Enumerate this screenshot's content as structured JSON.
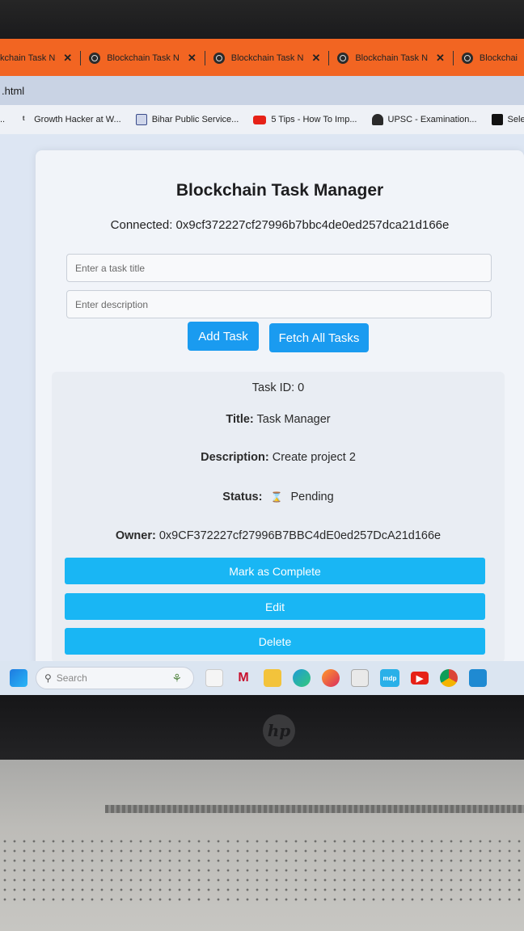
{
  "browser": {
    "tabs": [
      {
        "label": "kchain Task N"
      },
      {
        "label": "Blockchain Task N"
      },
      {
        "label": "Blockchain Task N"
      },
      {
        "label": "Blockchain Task N"
      },
      {
        "label": "Blockchai"
      }
    ],
    "address": ".html",
    "bookmarks": [
      {
        "label": "..",
        "icon": "ellipsis-icon"
      },
      {
        "label": "Growth Hacker at W...",
        "icon": "growth-hacker-icon"
      },
      {
        "label": "Bihar Public Service...",
        "icon": "bpsc-icon"
      },
      {
        "label": "5 Tips - How To Imp...",
        "icon": "youtube-icon"
      },
      {
        "label": "UPSC - Examination...",
        "icon": "upsc-emblem-icon"
      },
      {
        "label": "Sele",
        "icon": "bookmark-icon"
      }
    ]
  },
  "app": {
    "title": "Blockchain Task Manager",
    "connected_text": "Connected: 0x9cf372227cf27996b7bbc4de0ed257dca21d166e",
    "title_input_placeholder": "Enter a task title",
    "description_input_placeholder": "Enter description",
    "add_task_label": "Add Task",
    "fetch_all_label": "Fetch All Tasks",
    "accent_color": "#1a9bf0",
    "task": {
      "id_label": "Task ID:",
      "id_value": "0",
      "title_label": "Title:",
      "title_value": "Task Manager",
      "description_label": "Description:",
      "description_value": "Create project 2",
      "status_label": "Status:",
      "status_icon": "hourglass-icon",
      "status_value": "Pending",
      "owner_label": "Owner:",
      "owner_value": "0x9CF372227cf27996B7BBC4dE0ed257DcA21d166e",
      "mark_complete_label": "Mark as Complete",
      "edit_label": "Edit",
      "delete_label": "Delete"
    }
  },
  "taskbar": {
    "search_placeholder": "Search",
    "icons": [
      "widgets-icon",
      "mcafee-icon",
      "file-explorer-icon",
      "edge-icon",
      "firefox-icon",
      "calculator-icon",
      "mdp-icon",
      "youtube-icon",
      "chrome-icon",
      "vscode-icon"
    ]
  },
  "laptop": {
    "brand_logo": "hp"
  }
}
